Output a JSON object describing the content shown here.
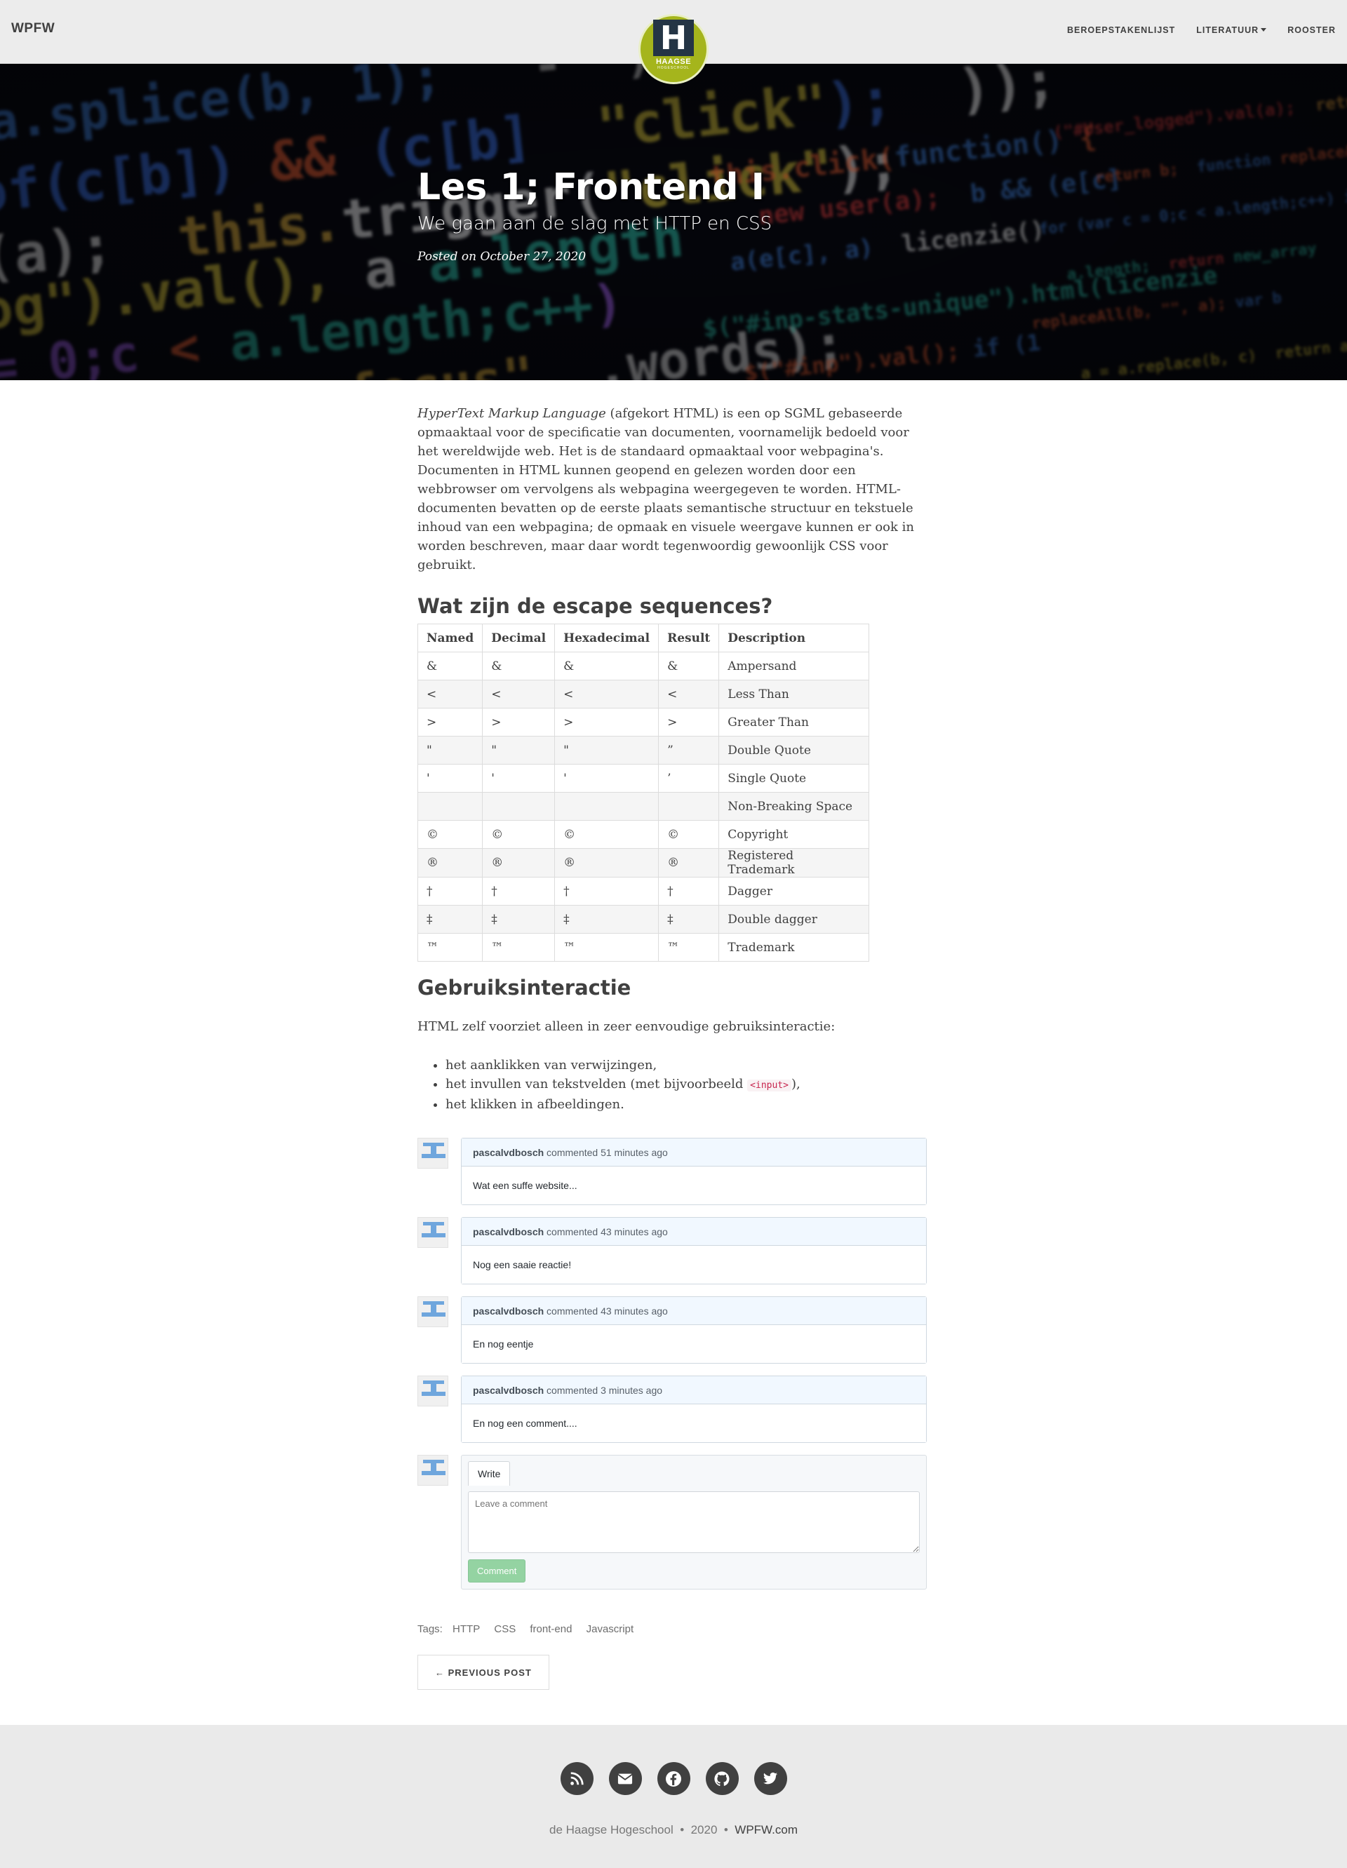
{
  "navbar": {
    "brand": "WPFW",
    "logo_text": "HAAGSE",
    "logo_letter": "H",
    "logo_sub": "HOGESCHOOL",
    "links": [
      {
        "label": "BEROEPSTAKENLIJST"
      },
      {
        "label": "LITERATUUR"
      },
      {
        "label": "ROOSTER"
      }
    ]
  },
  "hero": {
    "title": "Les 1; Frontend I",
    "subtitle": "We gaan aan de slag met HTTP en CSS",
    "posted": "Posted on October 27, 2020"
  },
  "article": {
    "intro_em": "HyperText Markup Language",
    "intro_rest": " (afgekort HTML) is een op SGML gebaseerde opmaaktaal voor de specificatie van documenten, voornamelijk bedoeld voor het wereldwijde web. Het is de standaard opmaaktaal voor webpagina's. Documenten in HTML kunnen geopend en gelezen worden door een webbrowser om vervolgens als webpagina weergegeven te worden. HTML-documenten bevatten op de eerste plaats semantische structuur en tekstuele inhoud van een webpagina; de opmaak en visuele weergave kunnen er ook in worden beschreven, maar daar wordt tegenwoordig gewoonlijk CSS voor gebruikt.",
    "escape_heading": "Wat zijn de escape sequences?",
    "table": {
      "headers": [
        "Named",
        "Decimal",
        "Hexadecimal",
        "Result",
        "Description"
      ],
      "rows": [
        [
          "&",
          "&",
          "&",
          "&",
          "Ampersand"
        ],
        [
          "<",
          "<",
          "<",
          "<",
          "Less Than"
        ],
        [
          ">",
          ">",
          ">",
          ">",
          "Greater Than"
        ],
        [
          "\"",
          "\"",
          "\"",
          "”",
          "Double Quote"
        ],
        [
          "'",
          "'",
          "'",
          "’",
          "Single Quote"
        ],
        [
          "",
          "",
          "",
          "",
          "Non-Breaking Space"
        ],
        [
          "©",
          "©",
          "©",
          "©",
          "Copyright"
        ],
        [
          "®",
          "®",
          "®",
          "®",
          "Registered Trademark"
        ],
        [
          "†",
          "†",
          "†",
          "†",
          "Dagger"
        ],
        [
          "‡",
          "‡",
          "‡",
          "‡",
          "Double dagger"
        ],
        [
          "™",
          "™",
          "™",
          "™",
          "Trademark"
        ]
      ]
    },
    "gebruik_heading": "Gebruiksinteractie",
    "gebruik_text": "HTML zelf voorziet alleen in zeer eenvoudige gebruiksinteractie:",
    "list": {
      "item1": "het aanklikken van verwijzingen,",
      "item2_pre": "het invullen van tekstvelden (met bijvoorbeeld ",
      "item2_code": "<input>",
      "item2_post": "),",
      "item3": "het klikken in afbeeldingen."
    }
  },
  "comments": [
    {
      "user": "pascalvdbosch",
      "action": "commented",
      "time": "51 minutes ago",
      "body": "Wat een suffe website..."
    },
    {
      "user": "pascalvdbosch",
      "action": "commented",
      "time": "43 minutes ago",
      "body": "Nog een saaie reactie!"
    },
    {
      "user": "pascalvdbosch",
      "action": "commented",
      "time": "43 minutes ago",
      "body": "En nog eentje"
    },
    {
      "user": "pascalvdbosch",
      "action": "commented",
      "time": "3 minutes ago",
      "body": "En nog een comment...."
    }
  ],
  "new_comment": {
    "tab": "Write",
    "placeholder": "Leave a comment",
    "button": "Comment"
  },
  "tags": {
    "label": "Tags:",
    "items": [
      "HTTP",
      "CSS",
      "front-end",
      "Javascript"
    ]
  },
  "pager": {
    "previous": "← PREVIOUS POST"
  },
  "footer": {
    "icons": [
      "rss-icon",
      "email-icon",
      "facebook-icon",
      "github-icon",
      "twitter-icon"
    ],
    "org": "de Haagse Hogeschool",
    "sep": "•",
    "year": "2020",
    "site": "WPFW.com"
  }
}
